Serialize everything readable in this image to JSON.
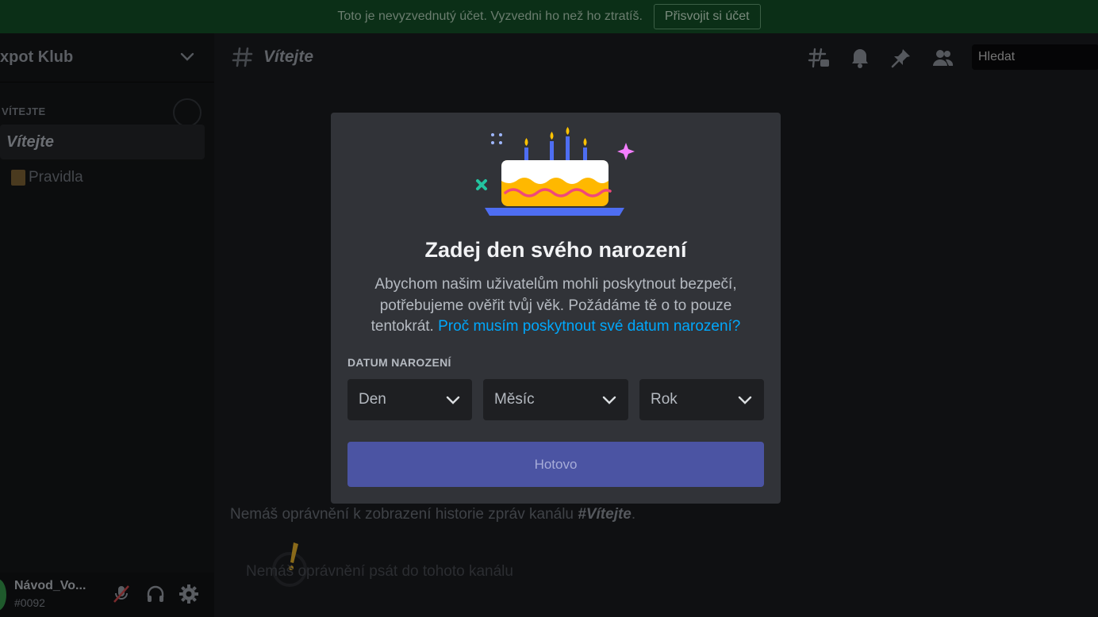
{
  "banner": {
    "text": "Toto je nevyzvednutý účet. Vyzvedni ho než ho ztratíš.",
    "button_label": "Přisvojit si účet"
  },
  "sidebar": {
    "server_name": "xpot Klub",
    "category": "VÍTEJTE",
    "active_channel": "Vítejte",
    "channels": [
      "Pravidla"
    ],
    "user": {
      "name": "Návod_Vo...",
      "tag": "#0092"
    }
  },
  "main": {
    "channel_title": "Vítejte",
    "search_placeholder": "Hledat",
    "no_permission_text": "Nemáš oprávnění k zobrazení historie zpráv kanálu ",
    "no_permission_channel": "#Vítejte",
    "no_permission_end": ".",
    "bottom_text": "Nemáš oprávnění psát do tohoto kanálu"
  },
  "modal": {
    "title": "Zadej den svého narození",
    "description": "Abychom našim uživatelům mohli poskytnout bezpečí, potřebujeme ověřit tvůj věk. Požádáme tě o to pouze tentokrát. ",
    "link_text": "Proč musím poskytnout své datum narození?",
    "field_label": "DATUM NAROZENÍ",
    "day_placeholder": "Den",
    "month_placeholder": "Měsíc",
    "year_placeholder": "Rok",
    "done_label": "Hotovo"
  },
  "colors": {
    "accent": "#5865f2",
    "link": "#00a8fc",
    "modal_bg": "#313338",
    "banner_bg": "#0b2f17"
  },
  "icons": [
    "hashtag-icon",
    "threads-icon",
    "bell-icon",
    "pin-icon",
    "members-icon",
    "chevron-down-icon",
    "mic-muted-icon",
    "headphones-icon",
    "gear-icon",
    "cake-illustration"
  ]
}
